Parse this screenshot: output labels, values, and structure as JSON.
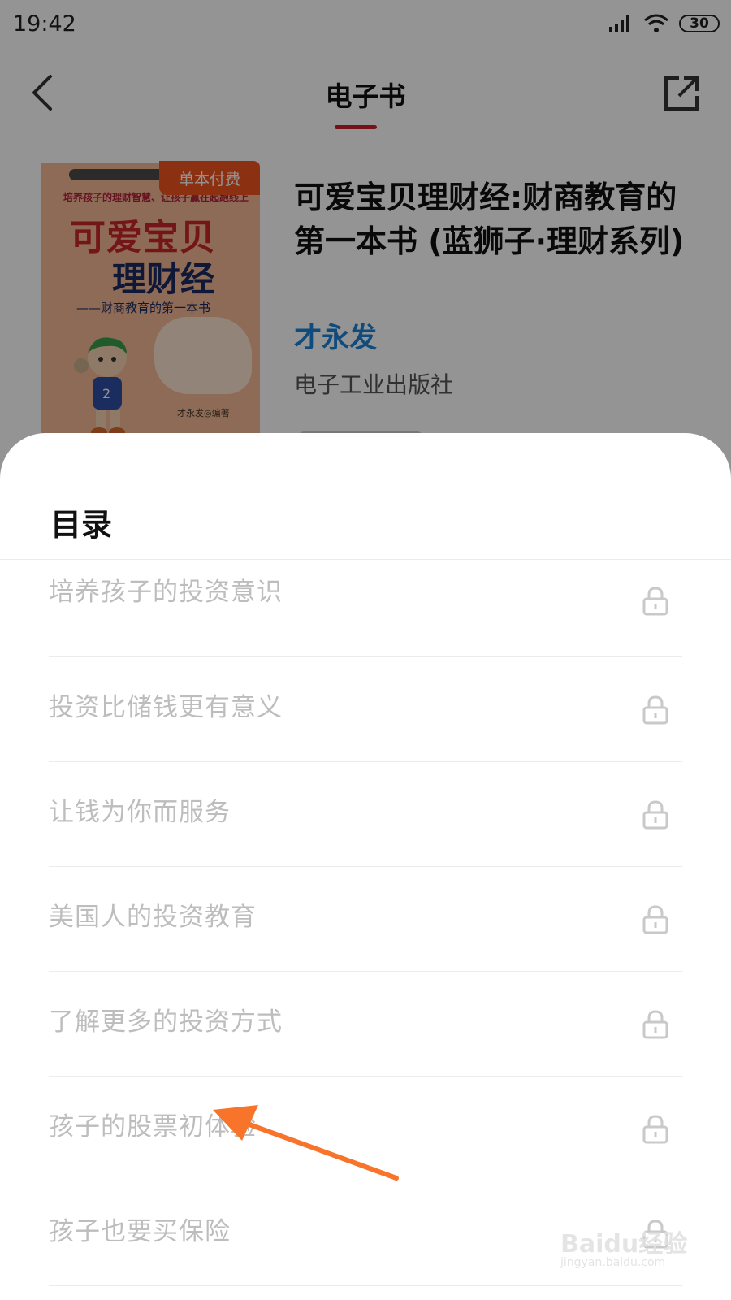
{
  "status_bar": {
    "time": "19:42",
    "battery": "30"
  },
  "header": {
    "title": "电子书"
  },
  "book": {
    "badge": "单本付费",
    "title": "可爱宝贝理财经:财商教育的第一本书 (蓝狮子·理财系列)",
    "author": "才永发",
    "publisher": "电子工业出版社",
    "cover": {
      "strip": "培养孩子的理财智慧、让孩子赢在起跑线上",
      "title_line1": "可爱宝贝",
      "title_line2": "理财经",
      "subtitle": "——财商教育的第一本书",
      "author": "才永发◎编著"
    }
  },
  "sheet": {
    "title": "目录",
    "chapters": [
      {
        "label": "培养孩子的投资意识",
        "locked": true
      },
      {
        "label": "投资比储钱更有意义",
        "locked": true
      },
      {
        "label": "让钱为你而服务",
        "locked": true
      },
      {
        "label": "美国人的投资教育",
        "locked": true
      },
      {
        "label": "了解更多的投资方式",
        "locked": true
      },
      {
        "label": "孩子的股票初体验",
        "locked": true
      },
      {
        "label": "孩子也要买保险",
        "locked": true
      }
    ]
  },
  "annotation": {
    "arrow_color": "#f7742a",
    "points_to": "孩子的股票初体验"
  },
  "watermark": {
    "logo_text": "Baidu经验",
    "url": "jingyan.baidu.com"
  },
  "colors": {
    "accent_red": "#c8202a",
    "author_blue": "#1d82d8",
    "badge_orange": "#f1541f",
    "locked_text": "#bdbdbd"
  }
}
